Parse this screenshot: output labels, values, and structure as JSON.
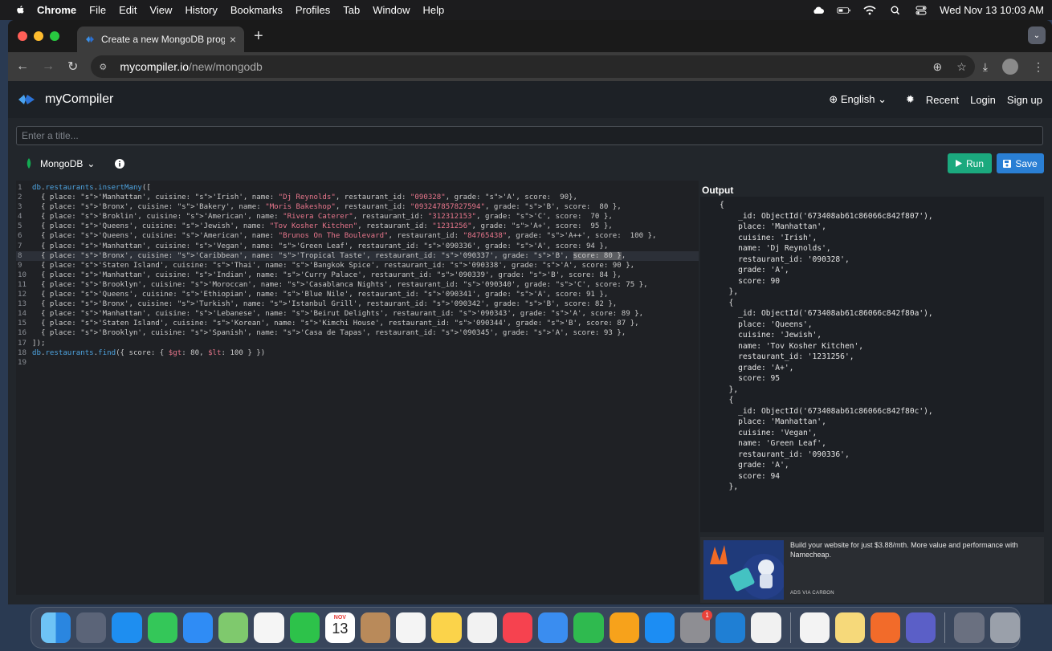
{
  "menubar": {
    "items": [
      "Chrome",
      "File",
      "Edit",
      "View",
      "History",
      "Bookmarks",
      "Profiles",
      "Tab",
      "Window",
      "Help"
    ],
    "clock": "Wed Nov 13  10:03 AM"
  },
  "browser": {
    "tab_title": "Create a new MongoDB progr",
    "url_host": "mycompiler.io",
    "url_path": "/new/mongodb"
  },
  "site": {
    "brand": "myCompiler",
    "language_label": "English",
    "nav": {
      "recent": "Recent",
      "login": "Login",
      "signup": "Sign up"
    },
    "title_placeholder": "Enter a title...",
    "lang_select": "MongoDB",
    "run_label": "Run",
    "save_label": "Save",
    "output_label": "Output"
  },
  "code_lines": [
    "db.restaurants.insertMany([",
    "  { place: 'Manhattan', cuisine: 'Irish', name: \"Dj Reynolds\", restaurant_id: \"090328\", grade: 'A', score:  90},",
    "  { place: 'Bronx', cuisine: 'Bakery', name: \"Moris Bakeshop\", restaurant_id: \"093247857827594\", grade: 'B', score:  80 },",
    "  { place: 'Broklin', cuisine: 'American', name: \"Rivera Caterer\", restaurant_id: \"312312153\", grade: 'C', score:  70 },",
    "  { place: 'Queens', cuisine: 'Jewish', name: \"Tov Kosher Kitchen\", restaurant_id: \"1231256\", grade: 'A+', score:  95 },",
    "  { place: 'Queens', cuisine: 'American', name: \"Brunos On The Boulevard\", restaurant_id: \"84765438\", grade: 'A++', score:  100 },",
    "  { place: 'Manhattan', cuisine: 'Vegan', name: 'Green Leaf', restaurant_id: '090336', grade: 'A', score: 94 },",
    "  { place: 'Bronx', cuisine: 'Caribbean', name: 'Tropical Taste', restaurant_id: '090337', grade: 'B', score: 80 },",
    "  { place: 'Staten Island', cuisine: 'Thai', name: 'Bangkok Spice', restaurant_id: '090338', grade: 'A', score: 90 },",
    "  { place: 'Manhattan', cuisine: 'Indian', name: 'Curry Palace', restaurant_id: '090339', grade: 'B', score: 84 },",
    "  { place: 'Brooklyn', cuisine: 'Moroccan', name: 'Casablanca Nights', restaurant_id: '090340', grade: 'C', score: 75 },",
    "  { place: 'Queens', cuisine: 'Ethiopian', name: 'Blue Nile', restaurant_id: '090341', grade: 'A', score: 91 },",
    "  { place: 'Bronx', cuisine: 'Turkish', name: 'Istanbul Grill', restaurant_id: '090342', grade: 'B', score: 82 },",
    "  { place: 'Manhattan', cuisine: 'Lebanese', name: 'Beirut Delights', restaurant_id: '090343', grade: 'A', score: 89 },",
    "  { place: 'Staten Island', cuisine: 'Korean', name: 'Kimchi House', restaurant_id: '090344', grade: 'B', score: 87 },",
    "  { place: 'Brooklyn', cuisine: 'Spanish', name: 'Casa de Tapas', restaurant_id: '090345', grade: 'A', score: 93 },",
    "]);",
    "db.restaurants.find({ score: { $gt: 80, $lt: 100 } })",
    ""
  ],
  "output_text": "{\n    _id: ObjectId('673408ab61c86066c842f807'),\n    place: 'Manhattan',\n    cuisine: 'Irish',\n    name: 'Dj Reynolds',\n    restaurant_id: '090328',\n    grade: 'A',\n    score: 90\n  },\n  {\n    _id: ObjectId('673408ab61c86066c842f80a'),\n    place: 'Queens',\n    cuisine: 'Jewish',\n    name: 'Tov Kosher Kitchen',\n    restaurant_id: '1231256',\n    grade: 'A+',\n    score: 95\n  },\n  {\n    _id: ObjectId('673408ab61c86066c842f80c'),\n    place: 'Manhattan',\n    cuisine: 'Vegan',\n    name: 'Green Leaf',\n    restaurant_id: '090336',\n    grade: 'A',\n    score: 94\n  },",
  "ad": {
    "text": "Build your website for just $3.88/mth. More value and performance with Namecheap.",
    "label": "ADS VIA CARBON"
  },
  "dock": {
    "calendar_month": "NOV",
    "calendar_day": "13",
    "badge": "1"
  },
  "colors": {
    "run": "#1ba97e",
    "save": "#2a7fd4",
    "keyword": "#4ea4e0",
    "string": "#e8768c"
  }
}
